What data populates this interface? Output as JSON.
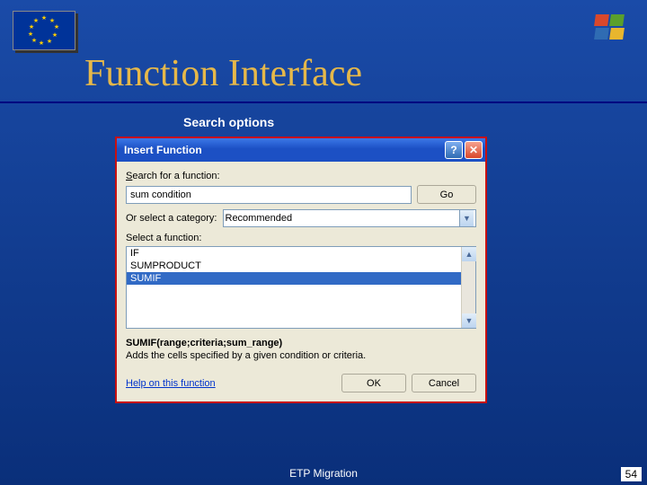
{
  "slide": {
    "title": "Function Interface",
    "subtitle": "Search options",
    "footer": "ETP Migration",
    "pageNumber": "54"
  },
  "dialog": {
    "title": "Insert Function",
    "searchLabel": "Search for a function:",
    "searchValue": "sum condition",
    "goLabel": "Go",
    "categoryLabel": "Or select a category:",
    "categoryValue": "Recommended",
    "selectFuncLabel": "Select a function:",
    "functions": {
      "0": "IF",
      "1": "SUMPRODUCT",
      "2": "SUMIF"
    },
    "syntax": "SUMIF(range;criteria;sum_range)",
    "description": "Adds the cells specified by a given condition or criteria.",
    "helpLink": "Help on this function",
    "okLabel": "OK",
    "cancelLabel": "Cancel"
  }
}
